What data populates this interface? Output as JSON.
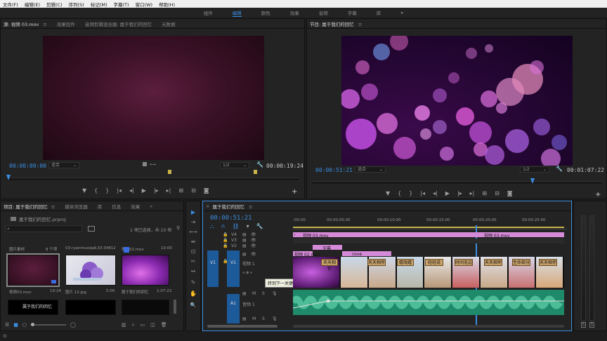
{
  "menu": [
    "文件(F)",
    "编辑(E)",
    "剪辑(C)",
    "序列(S)",
    "标记(M)",
    "字幕(T)",
    "窗口(W)",
    "帮助(H)"
  ],
  "workspaces": {
    "items": [
      "组件",
      "编辑",
      "颜色",
      "效果",
      "音频",
      "字幕",
      "库"
    ],
    "active": 1,
    "more": "»"
  },
  "source_panel": {
    "tabs": [
      "源: 视频 03.mov",
      "效果控件",
      "音频剪辑混合器: 属于我们的回忆",
      "元数据"
    ],
    "menu_icon": "≡",
    "timecode_in": "00:00:00:00",
    "fit": "适合",
    "fraction": "1/2",
    "timecode_out": "00:00:19:24"
  },
  "program_panel": {
    "tab": "节目: 属于我们的回忆",
    "menu_icon": "≡",
    "timecode_in": "00:00:51:21",
    "fit": "适合",
    "fraction": "1/2",
    "timecode_out": "00:01:07:22"
  },
  "transport": {
    "marker": "▼",
    "in": "{",
    "out": "}",
    "go_in": "|◂",
    "step_back": "◂|",
    "play": "▶",
    "step_fwd": "|▸",
    "go_out": "▸|",
    "insert": "⊞",
    "overwrite": "⊟",
    "export": "◙",
    "add": "+"
  },
  "project_panel": {
    "tabs": [
      "项目: 属于我们的回忆",
      "媒体浏览器",
      "库",
      "信息",
      "效果"
    ],
    "more": "»",
    "file": "属于我们的回忆.prproj",
    "selection": "1 项已选择，共 10 项",
    "items": [
      {
        "name": "视频03.mov",
        "duration": "19:24",
        "header_left": "图片素材",
        "header_right": "8 个项"
      },
      {
        "name": "图片 12.jpg",
        "duration": "5:00",
        "header_left": "03-ryanmusiqu...",
        "header_right": "4:33:34812"
      },
      {
        "name": "属于我们的回忆",
        "duration": "1:07:22",
        "header_left": "视频02.mov",
        "header_right": "10:00"
      },
      {
        "name": "属于我们的回忆",
        "duration": ""
      }
    ]
  },
  "tools": [
    "▶",
    "⇥",
    "⟷",
    "⇹",
    "⊡",
    "✂",
    "↔",
    "✎",
    "✋",
    "🔍"
  ],
  "timeline": {
    "tab": "属于我们的回忆",
    "menu_icon": "≡",
    "timecode": "00:00:51:21",
    "ruler": [
      ":00:00",
      "00:00:05:00",
      "00:00:10:00",
      "00:00:15:00",
      "00:00:20:00",
      "00:00:25:00"
    ],
    "tracks": {
      "v4": "V4",
      "v3": "V3",
      "v2": "V2",
      "v1": "V1",
      "a1": "A1"
    },
    "v1_name": "视频 1",
    "a1_name": "音频 1",
    "tooltip": "转到下一关键帧",
    "clips": {
      "v4_clip_a": "视频 03.mov",
      "v4_clip_b": "视频 03.mov",
      "v2_clip": "字幕",
      "v3_clip": "cove",
      "v1_clip": "视频 02.mov",
      "v1_fx": "fx",
      "title_cards": [
        "天天相伴",
        "天天相伴",
        "嬉戏嬉",
        "轻轻说",
        "时间无边",
        "天天相伴",
        "生命部分",
        "天天相伴"
      ]
    }
  },
  "audio_meter": {
    "labels": [
      "S",
      "S"
    ]
  },
  "colors": {
    "accent": "#3a8de0",
    "panel_bg": "#232323",
    "clip_purple": "#d58ad8",
    "audio_green": "#2fb88a"
  }
}
